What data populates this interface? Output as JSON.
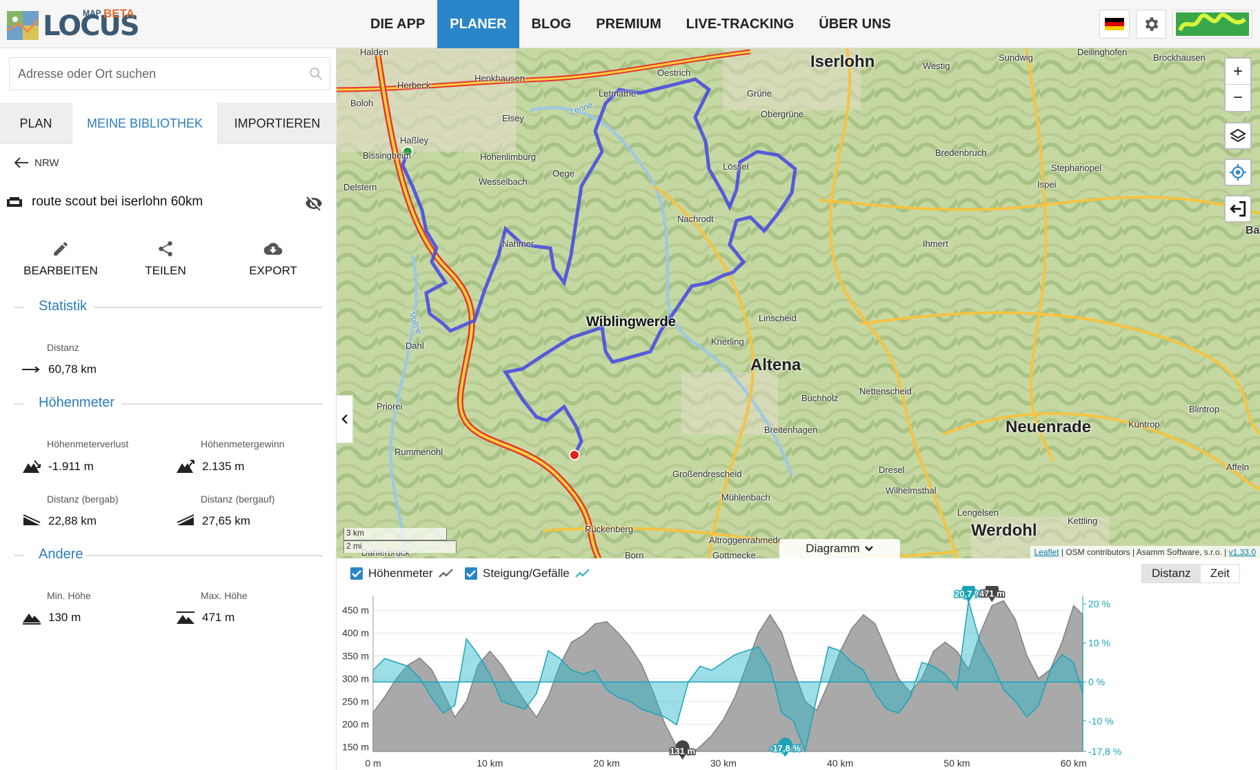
{
  "header": {
    "logo_map": "MAP",
    "logo_text": "LOCUS",
    "logo_beta": "BETA",
    "nav": [
      "DIE APP",
      "PLANER",
      "BLOG",
      "PREMIUM",
      "LIVE-TRACKING",
      "ÜBER UNS"
    ],
    "active_nav": "PLANER",
    "icons": [
      "german-flag-icon",
      "gear-icon",
      "user-avatar"
    ]
  },
  "search": {
    "placeholder": "Adresse oder Ort suchen"
  },
  "tabs": [
    "PLAN",
    "MEINE BIBLIOTHEK",
    "IMPORTIEREN"
  ],
  "back_label": "NRW",
  "route_name": "route scout bei iserlohn 60km",
  "actions": [
    "BEARBEITEN",
    "TEILEN",
    "EXPORT"
  ],
  "sections": {
    "statistik": "Statistik",
    "hoehenmeter": "Höhenmeter",
    "andere": "Andere"
  },
  "stats": {
    "distanz_label": "Distanz",
    "distanz_value": "60,78 km",
    "verlust_label": "Höhenmeterverlust",
    "verlust_value": "-1.911 m",
    "gewinn_label": "Höhenmetergewinn",
    "gewinn_value": "2.135 m",
    "bergab_label": "Distanz (bergab)",
    "bergab_value": "22,88 km",
    "bergauf_label": "Distanz (bergauf)",
    "bergauf_value": "27,65 km",
    "min_label": "Min. Höhe",
    "min_value": "130 m",
    "max_label": "Max. Höhe",
    "max_value": "471 m"
  },
  "map": {
    "places": [
      "Halden",
      "Herbeck",
      "Henkhausen",
      "Boloh",
      "Oestrich",
      "Letmathe",
      "Iserlohn",
      "Westig",
      "Sundwig",
      "Deilinghofen",
      "Brockhausen",
      "Grüne",
      "Obergrüne",
      "Elsey",
      "Haßley",
      "Bissingheim",
      "Hohenlimburg",
      "Delstern",
      "Wesselbach",
      "Oege",
      "Lössel",
      "Bredenbruch",
      "Stephanopel",
      "Ispei",
      "Nachrodt",
      "Nahmer",
      "Ihmert",
      "Wiblingwerde",
      "Linscheid",
      "Dahl",
      "Knerling",
      "Altena",
      "Buchholz",
      "Nettenscheid",
      "Priorei",
      "Breitenhagen",
      "Neuenrade",
      "Küntrop",
      "Blintrop",
      "Rummenohl",
      "Großendrescheid",
      "Dresel",
      "Wilhelmsthal",
      "Affeln",
      "Mühlenbach",
      "Lengelsen",
      "Kettling",
      "Werdohl",
      "Rückenberg",
      "Altroggenrahmede",
      "Gottmecke",
      "Dahlerbrück",
      "Born",
      "Ba",
      "Volme",
      "Lenne"
    ],
    "zoom_in": "+",
    "zoom_out": "−",
    "scale_km": "3 km",
    "scale_mi": "2 mi",
    "attribution_leaflet": "Leaflet",
    "attribution_rest": " | OSM contributors | Asamm Software, s.r.o. | ",
    "version": "v1.33.0",
    "diagram_label": "Diagramm"
  },
  "chart_panel": {
    "cb_elevation": "Höhenmeter",
    "cb_slope": "Steigung/Gefälle",
    "seg_distance": "Distanz",
    "seg_time": "Zeit"
  },
  "chart_data": {
    "type": "area",
    "x_unit": "km",
    "x_ticks": [
      "0 m",
      "10 km",
      "20 km",
      "30 km",
      "40 km",
      "50 km",
      "60 km"
    ],
    "y_left_ticks": [
      "450 m",
      "400 m",
      "350 m",
      "300 m",
      "250 m",
      "200 m",
      "150 m"
    ],
    "y_right_ticks": [
      "20 %",
      "10 %",
      "0 %",
      "-10 %",
      "-17,8 %"
    ],
    "xlim": [
      0,
      60.78
    ],
    "ylim_left": [
      130,
      471
    ],
    "ylim_right": [
      -17.8,
      20.7
    ],
    "series": [
      {
        "name": "Höhenmeter",
        "color": "#9a9a9a",
        "x": [
          0,
          1,
          2,
          3,
          4,
          5,
          6,
          7,
          8,
          9,
          10,
          11,
          12,
          13,
          14,
          15,
          16,
          17,
          18,
          19,
          20,
          21,
          22,
          23,
          24,
          25,
          26,
          27,
          28,
          29,
          30,
          31,
          32,
          33,
          34,
          35,
          36,
          37,
          38,
          39,
          40,
          41,
          42,
          43,
          44,
          45,
          46,
          47,
          48,
          49,
          50,
          51,
          52,
          53,
          54,
          55,
          56,
          57,
          58,
          59,
          60,
          60.78
        ],
        "values": [
          225,
          260,
          300,
          330,
          345,
          320,
          270,
          215,
          250,
          330,
          360,
          330,
          290,
          250,
          215,
          260,
          330,
          380,
          395,
          420,
          425,
          400,
          370,
          330,
          270,
          200,
          150,
          131,
          150,
          175,
          210,
          260,
          330,
          400,
          440,
          400,
          320,
          250,
          230,
          290,
          360,
          410,
          440,
          420,
          360,
          300,
          270,
          300,
          360,
          380,
          360,
          320,
          400,
          460,
          471,
          430,
          350,
          300,
          320,
          380,
          460,
          440
        ]
      },
      {
        "name": "Steigung/Gefälle",
        "color": "#26b6c9",
        "x": [
          0,
          1,
          2,
          3,
          4,
          5,
          6,
          7,
          8,
          9,
          10,
          11,
          12,
          13,
          14,
          15,
          16,
          17,
          18,
          19,
          20,
          21,
          22,
          23,
          24,
          25,
          26,
          27,
          28,
          29,
          30,
          31,
          32,
          33,
          34,
          35,
          36,
          37,
          38,
          39,
          40,
          41,
          42,
          43,
          44,
          45,
          46,
          47,
          48,
          49,
          50,
          51,
          52,
          53,
          54,
          55,
          56,
          57,
          58,
          59,
          60,
          60.78
        ],
        "values": [
          3,
          6,
          5,
          4,
          1,
          -4,
          -8,
          -6,
          11,
          7,
          2,
          -5,
          -6,
          -7,
          -3,
          8,
          6,
          3,
          2,
          3,
          -2,
          -4,
          -5,
          -7,
          -8,
          -9,
          -11,
          0,
          4,
          3,
          5,
          7,
          8,
          9,
          4,
          -8,
          -10,
          -17.8,
          -4,
          9,
          8,
          5,
          3,
          -3,
          -7,
          -8,
          -4,
          5,
          4,
          2,
          -2,
          20.7,
          10,
          5,
          -2,
          -5,
          -9,
          -6,
          3,
          7,
          5,
          -3
        ]
      }
    ],
    "markers": [
      {
        "label": "20,7 %",
        "x": 51
      },
      {
        "label": "471 m",
        "x": 53
      },
      {
        "label": "131 m",
        "x": 26.5
      },
      {
        "label": "-17,8 %",
        "x": 35.3
      }
    ],
    "grid": true
  }
}
